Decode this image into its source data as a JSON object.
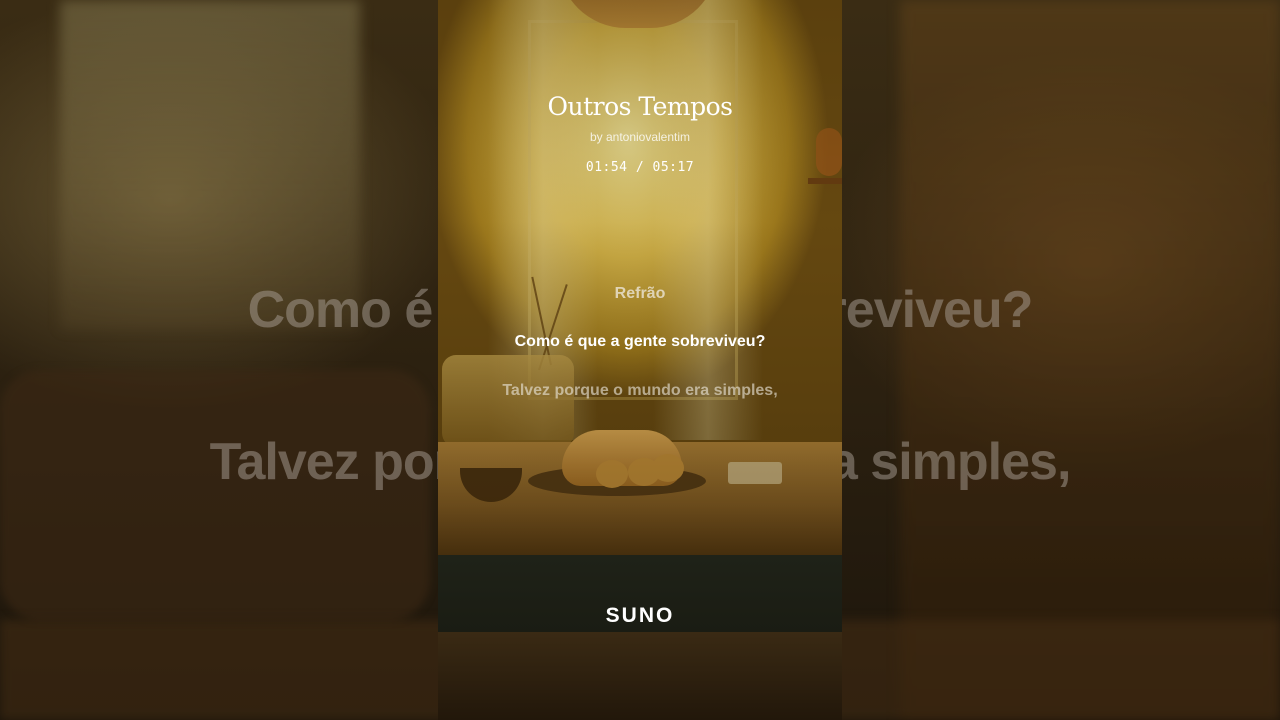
{
  "song": {
    "title": "Outros Tempos",
    "artist": "by antoniovalentim",
    "time": "01:54 / 05:17"
  },
  "lyrics": {
    "section": "Refrão",
    "current": "Como é que a gente sobreviveu?",
    "next": "Talvez porque o mundo era simples,"
  },
  "backdrop": {
    "line1": "Como é que a gente sobreviveu?",
    "line2": "Talvez porque o mundo era simples,"
  },
  "brand": {
    "logo": "SUNO"
  },
  "colors": {
    "accent_warm": "#d9b84a",
    "text": "#ffffff"
  }
}
